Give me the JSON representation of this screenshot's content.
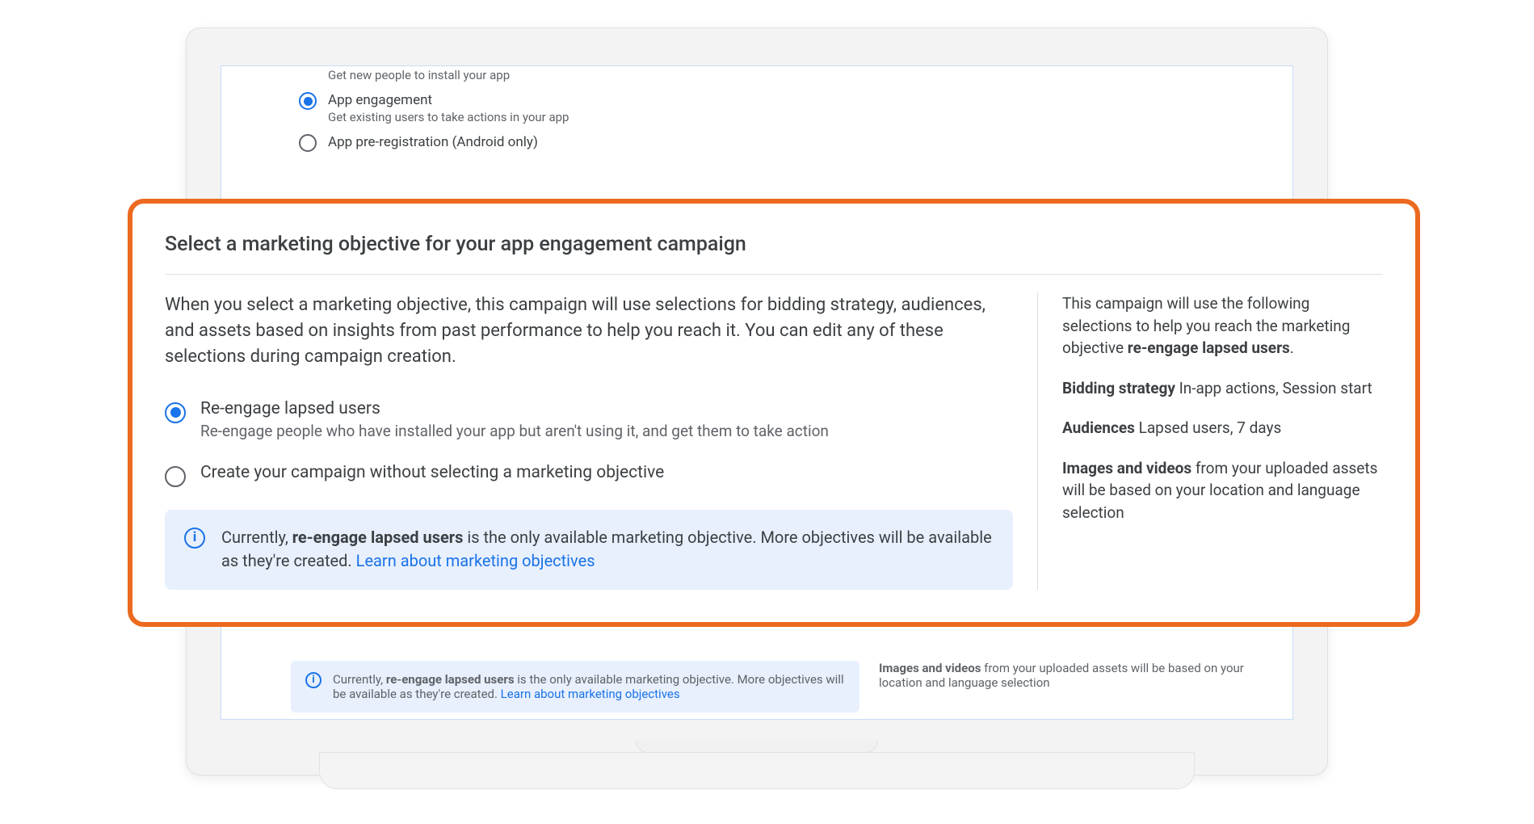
{
  "bg": {
    "installs_desc": "Get new people to install your app",
    "engagement_title": "App engagement",
    "engagement_desc": "Get existing users to take actions in your app",
    "prereg_title": "App pre-registration (Android only)"
  },
  "callout": {
    "heading": "Select a marketing objective for your app engagement campaign",
    "intro": "When you select a marketing objective, this campaign will use selections for bidding strategy, audiences, and assets based on insights from past performance to help you reach it. You can edit any of these selections during campaign creation.",
    "opt1_title": "Re-engage lapsed users",
    "opt1_desc": "Re-engage people who have installed your app but aren't using it, and get them to take action",
    "opt2_title": "Create your campaign without selecting a marketing objective",
    "info_prefix": "Currently, ",
    "info_bold": "re-engage lapsed users",
    "info_suffix": " is the only available marketing objective. More objectives will be available as they're created. ",
    "info_link": "Learn about marketing objectives"
  },
  "side": {
    "intro_prefix": "This campaign will use the following selections to help you reach the marketing objective ",
    "intro_bold": "re-engage lapsed users",
    "intro_suffix": ".",
    "bid_label": "Bidding strategy",
    "bid_value": " In-app actions, Session start",
    "aud_label": "Audiences",
    "aud_value": " Lapsed users, 7 days",
    "assets_label": "Images and videos",
    "assets_value": " from your uploaded assets will be based on your location and language selection"
  }
}
